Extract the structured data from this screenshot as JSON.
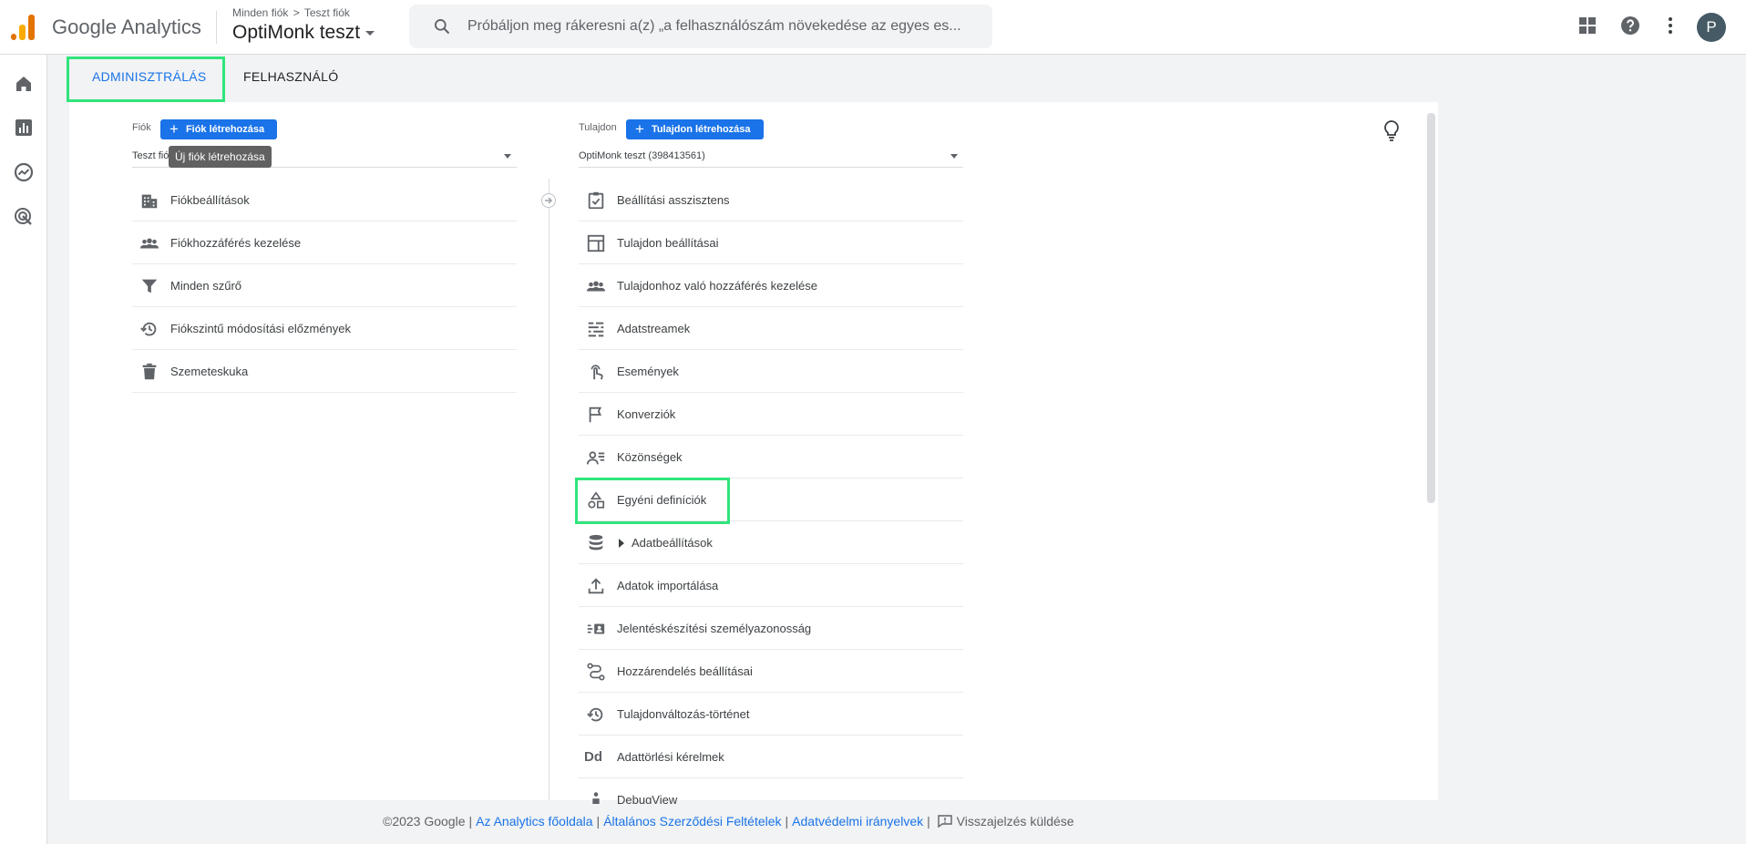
{
  "header": {
    "brand": "Google Analytics",
    "breadcrumb_account_all": "Minden fiók",
    "breadcrumb_account": "Teszt fiók",
    "property": "OptiMonk teszt",
    "search_placeholder": "Próbáljon meg rákeresni a(z) „a felhasználószám növekedése az egyes es...",
    "avatar_initial": "P"
  },
  "tabs": {
    "admin": "ADMINISZTRÁLÁS",
    "user": "FELHASZNÁLÓ"
  },
  "account_column": {
    "label": "Fiók",
    "create_button": "Fiók létrehozása",
    "selected": "Teszt fiók",
    "tooltip": "Új fiók létrehozása",
    "items": [
      {
        "label": "Fiókbeállítások",
        "icon": "building-icon"
      },
      {
        "label": "Fiókhozzáférés kezelése",
        "icon": "people-icon"
      },
      {
        "label": "Minden szűrő",
        "icon": "filter-icon"
      },
      {
        "label": "Fiókszintű módosítási előzmények",
        "icon": "history-icon"
      },
      {
        "label": "Szemeteskuka",
        "icon": "trash-icon"
      }
    ]
  },
  "property_column": {
    "label": "Tulajdon",
    "create_button": "Tulajdon létrehozása",
    "selected": "OptiMonk teszt (398413561)",
    "items": [
      {
        "label": "Beállítási asszisztens",
        "icon": "checklist-icon"
      },
      {
        "label": "Tulajdon beállításai",
        "icon": "layout-icon"
      },
      {
        "label": "Tulajdonhoz való hozzáférés kezelése",
        "icon": "people-icon"
      },
      {
        "label": "Adatstreamek",
        "icon": "streams-icon"
      },
      {
        "label": "Események",
        "icon": "touch-icon"
      },
      {
        "label": "Konverziók",
        "icon": "flag-icon"
      },
      {
        "label": "Közönségek",
        "icon": "audience-icon"
      },
      {
        "label": "Egyéni definíciók",
        "icon": "shapes-icon"
      },
      {
        "label": "Adatbeállítások",
        "icon": "database-icon"
      },
      {
        "label": "Adatok importálása",
        "icon": "upload-icon"
      },
      {
        "label": "Jelentéskészítési személyazonosság",
        "icon": "identity-icon"
      },
      {
        "label": "Hozzárendelés beállításai",
        "icon": "attribution-icon"
      },
      {
        "label": "Tulajdonváltozás-történet",
        "icon": "history-icon"
      },
      {
        "label": "Adattörlési kérelmek",
        "icon": "dd-icon"
      },
      {
        "label": "DebugView",
        "icon": "debug-icon"
      }
    ]
  },
  "footer": {
    "copyright": "©2023 Google",
    "link_home": "Az Analytics főoldala",
    "link_terms": "Általános Szerződési Feltételek",
    "link_privacy": "Adatvédelmi irányelvek",
    "feedback": "Visszajelzés küldése"
  },
  "colors": {
    "accent": "#1a73e8",
    "tab_underline": "#e37400",
    "highlight": "#2fe57a"
  }
}
